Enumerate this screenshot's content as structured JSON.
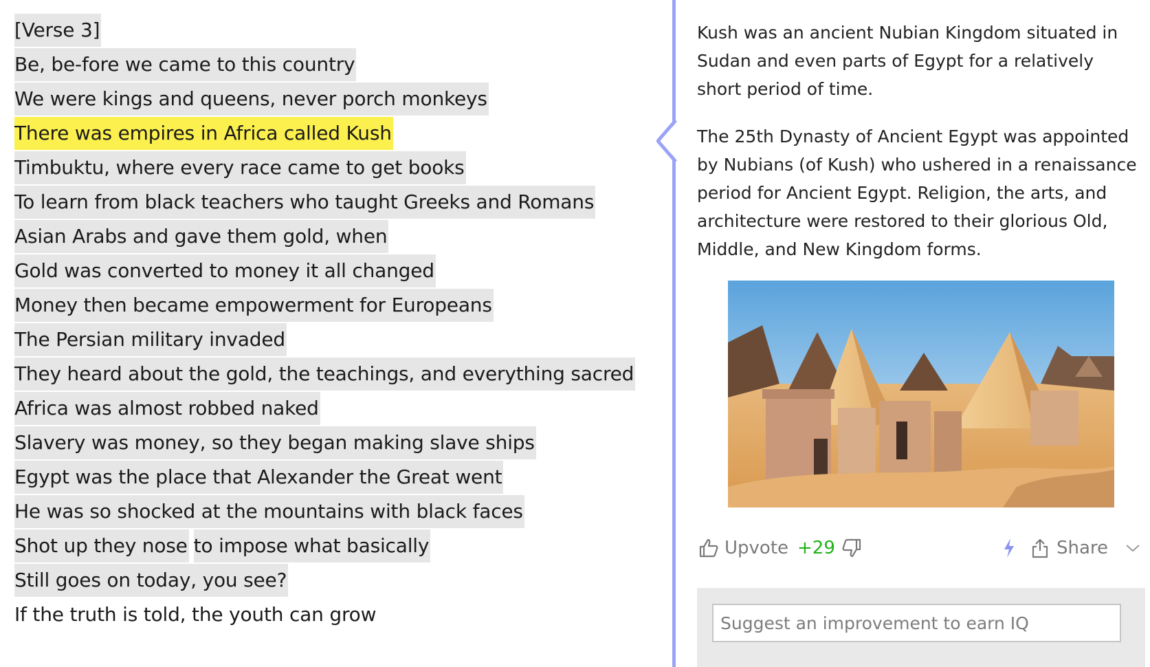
{
  "lyrics": [
    {
      "segments": [
        {
          "text": "[Verse 3]",
          "style": "ann"
        }
      ]
    },
    {
      "segments": [
        {
          "text": "Be, be-fore we came to this country",
          "style": "ann"
        }
      ]
    },
    {
      "segments": [
        {
          "text": "We were kings and queens, never porch monkeys",
          "style": "ann"
        }
      ]
    },
    {
      "segments": [
        {
          "text": "There was empires in Africa called Kush",
          "style": "hl"
        }
      ]
    },
    {
      "segments": [
        {
          "text": "Timbuktu, where every race came to get books",
          "style": "ann"
        }
      ]
    },
    {
      "segments": [
        {
          "text": "To learn from black teachers who taught Greeks and Romans",
          "style": "ann"
        }
      ]
    },
    {
      "segments": [
        {
          "text": "Asian Arabs and gave them gold, when",
          "style": "ann"
        }
      ]
    },
    {
      "segments": [
        {
          "text": "Gold was converted to money it all changed",
          "style": "ann"
        }
      ]
    },
    {
      "segments": [
        {
          "text": "Money then became empowerment for Europeans",
          "style": "ann"
        }
      ]
    },
    {
      "segments": [
        {
          "text": "The Persian military invaded",
          "style": "ann"
        }
      ]
    },
    {
      "segments": [
        {
          "text": "They heard about the gold, the teachings, and everything sacred",
          "style": "ann"
        }
      ]
    },
    {
      "segments": [
        {
          "text": "Africa was almost robbed naked",
          "style": "ann"
        }
      ]
    },
    {
      "segments": [
        {
          "text": "Slavery was money, so they began making slave ships",
          "style": "ann"
        }
      ]
    },
    {
      "segments": [
        {
          "text": "Egypt was the place that Alexander the Great went",
          "style": "ann"
        }
      ]
    },
    {
      "segments": [
        {
          "text": "He was so shocked at the mountains with black faces",
          "style": "ann"
        }
      ]
    },
    {
      "segments": [
        {
          "text": "Shot up they nose",
          "style": "ann"
        },
        {
          "text": "to impose what basically",
          "style": "ann"
        }
      ]
    },
    {
      "segments": [
        {
          "text": "Still goes on today, you see?",
          "style": "ann"
        }
      ]
    },
    {
      "segments": [
        {
          "text": "If the truth is told, the youth can grow",
          "style": "plain"
        }
      ]
    }
  ],
  "annotation": {
    "paragraph1": "Kush was an ancient Nubian Kingdom situated in Sudan and even parts of Egypt for a relatively short period of time.",
    "paragraph2": "The 25th Dynasty of Ancient Egypt was appointed by Nubians (of Kush) who ushered in a renaissance period for Ancient Egypt. Religion, the arts, and architecture were restored to their glorious Old, Middle, and New Kingdom forms.",
    "image_subject": "nubian-pyramids-photo"
  },
  "actions": {
    "upvote_label": "Upvote",
    "vote_count": "+29",
    "share_label": "Share",
    "icons": {
      "upvote": "thumbs-up-icon",
      "downvote": "thumbs-down-icon",
      "bolt": "lightning-bolt-icon",
      "share": "share-icon",
      "more": "chevron-down-icon"
    }
  },
  "suggest": {
    "placeholder": "Suggest an improvement to earn IQ"
  },
  "colors": {
    "highlight": "#fbf04d",
    "annotated_background": "#e6e6e6",
    "divider": "#9aa3f5",
    "vote_count": "#1fb319",
    "bolt": "#8b93f0"
  }
}
